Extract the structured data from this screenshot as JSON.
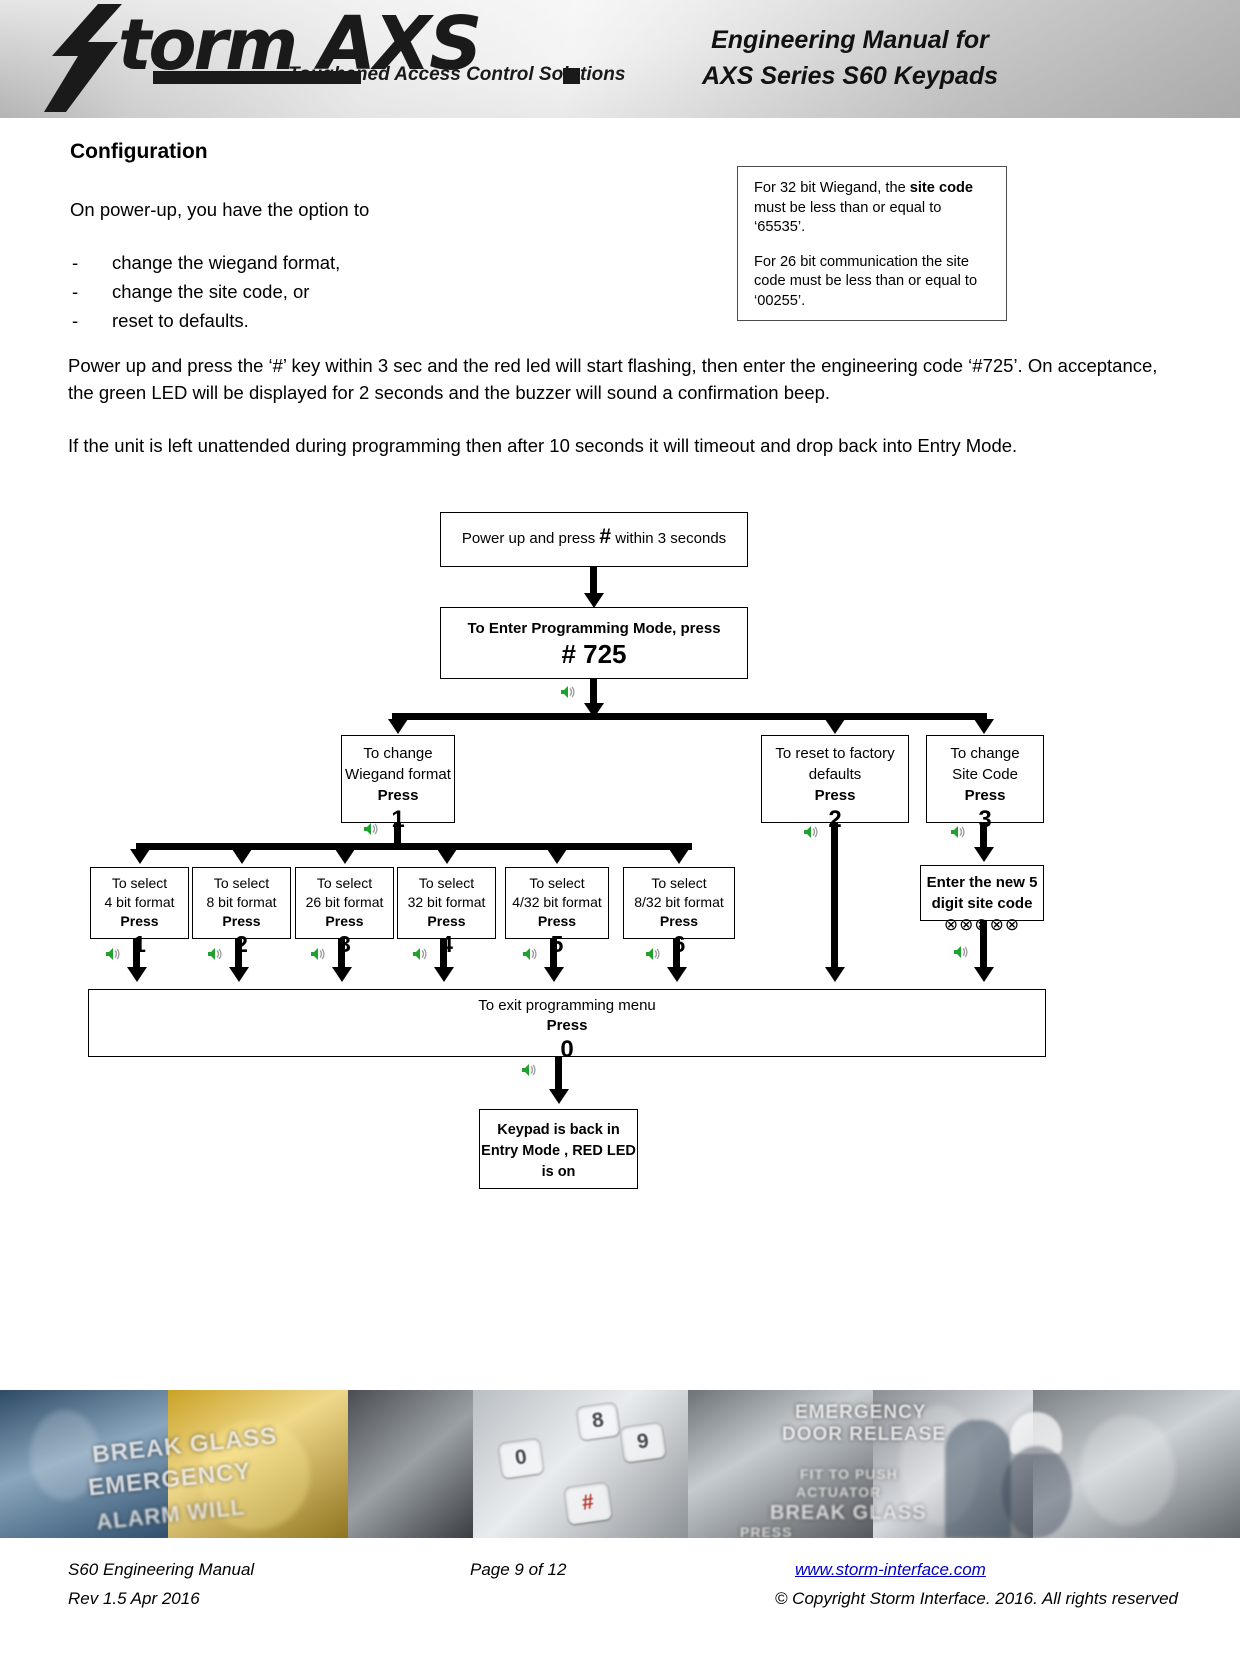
{
  "header": {
    "logo_storm": "torm",
    "logo_axs": "AXS",
    "logo_tagline": "Toughened Access Control Solutions",
    "title_line1": "Engineering Manual for",
    "title_line2": "AXS Series S60 Keypads"
  },
  "content": {
    "section_title": "Configuration",
    "intro": "On power-up, you have the option to",
    "bullets": [
      {
        "dash": "-",
        "text": "change the wiegand format,"
      },
      {
        "dash": "-",
        "text": "change the site code, or"
      },
      {
        "dash": "-",
        "text": "reset to defaults."
      }
    ],
    "para_powerup": "Power up and press the ‘#’ key within 3 sec and the red led will start flashing, then enter the engineering code ‘#725’. On acceptance, the green LED will be displayed for 2 seconds and the buzzer will sound a confirmation beep.",
    "para_timeout": "If the unit is left unattended during programming then after 10 seconds it will timeout and drop back into Entry Mode."
  },
  "infobox": {
    "p1_a": "For 32 bit Wiegand, the ",
    "p1_bold": "site code",
    "p1_b": " must be less than or equal to ‘65535’.",
    "p2": "For 26 bit communication the site code must be less than or equal to ‘00255’."
  },
  "flowchart": {
    "powerup": {
      "pre": "Power up and press  ",
      "key": "#",
      "post": " within 3 seconds"
    },
    "enter_mode": {
      "line1": "To Enter Programming Mode, press",
      "line2": "# 725"
    },
    "change_wiegand": {
      "line1": "To change",
      "line2": "Wiegand format",
      "line3": "Press",
      "key": "1"
    },
    "reset_defaults": {
      "line1": "To reset to factory",
      "line2": "defaults",
      "line3": "Press",
      "key": "2"
    },
    "change_site": {
      "line1": "To change",
      "line2": "Site Code",
      "line3": "Press",
      "key": "3"
    },
    "new_site_code": {
      "line1": "Enter the new 5",
      "line2": "digit site code",
      "dots": "⊗⊗⊗⊗⊗"
    },
    "formats": [
      {
        "line1": "To select",
        "line2": "4 bit format",
        "line3": "Press",
        "key": "1"
      },
      {
        "line1": "To select",
        "line2": "8 bit format",
        "line3": "Press",
        "key": "2"
      },
      {
        "line1": "To select",
        "line2": "26 bit format",
        "line3": "Press",
        "key": "3"
      },
      {
        "line1": "To select",
        "line2": "32 bit format",
        "line3": "Press",
        "key": "4"
      },
      {
        "line1": "To select",
        "line2": "4/32 bit format",
        "line3": "Press",
        "key": "5"
      },
      {
        "line1": "To select",
        "line2": "8/32 bit format",
        "line3": "Press",
        "key": "6"
      }
    ],
    "exit": {
      "line1": "To exit programming menu",
      "line2": "Press",
      "key": "0"
    },
    "entry_mode": {
      "line1": "Keypad is back in",
      "line2": "Entry Mode , RED LED",
      "line3": "is on"
    },
    "beep_icon": "speaker-beep-icon",
    "beep_color": "#1fa12f"
  },
  "photostrip": {
    "labels": [
      "BREAK GLASS",
      "EMERGENCY",
      "ALARM WILL",
      "EMERGENCY",
      "DOOR RELEASE",
      "FIT TO PUSH",
      "ACTUATOR",
      "BREAK GLASS",
      "PRESS"
    ],
    "keycaps": [
      "8",
      "0",
      "9",
      "#"
    ]
  },
  "footer": {
    "left_line1": "S60  Engineering Manual",
    "left_line2": "Rev 1.5 Apr 2016",
    "center": "Page 9 of 12",
    "url": "www.storm-interface.com",
    "copyright": "© Copyright Storm Interface. 2016. All rights reserved"
  }
}
